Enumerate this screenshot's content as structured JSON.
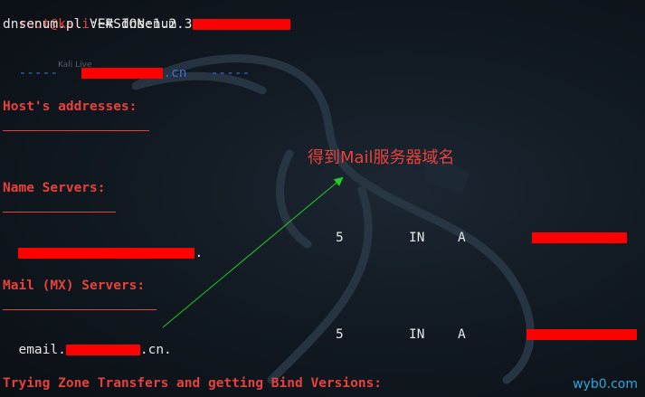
{
  "terminal": {
    "prompt_user": "root@kali",
    "prompt_rest": ":~# ",
    "command": "dnsenum  ",
    "command_suffix": "",
    "version_line": "dnsenum.pl VERSION:1.2.3",
    "target_prefix": "-----   ",
    "target_suffix": ".cn   -----",
    "faint_label": "Kali Live"
  },
  "sections": {
    "hosts": "Host's addresses:",
    "hosts_rule": "__________________",
    "ns": "Name Servers:",
    "ns_rule": "______________",
    "mx": "Mail (MX) Servers:",
    "mx_rule": "___________________",
    "zone": "Trying Zone Transfers and getting Bind Versions:"
  },
  "ns_row": {
    "name_suffix": ".",
    "ttl": "5",
    "class": "IN",
    "type": "A"
  },
  "mx_row": {
    "name_prefix": "email.",
    "name_suffix": ".cn.",
    "ttl": "5",
    "class": "IN",
    "type": "A"
  },
  "annotation": "得到Mail服务器域名",
  "watermark": "wyb0.com",
  "colors": {
    "accent_red": "#e8413c",
    "redaction": "#ff0000",
    "arrow": "#22cc22",
    "watermark": "#2aa9e0"
  }
}
